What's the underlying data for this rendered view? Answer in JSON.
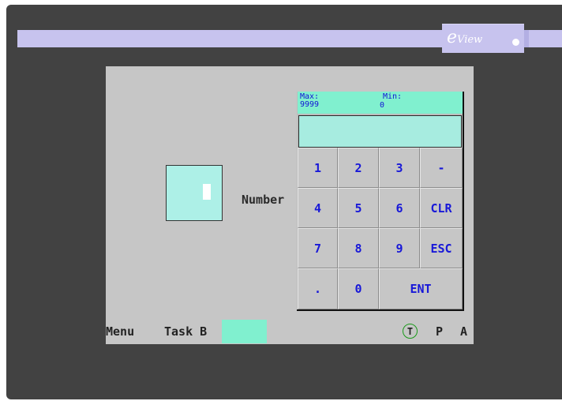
{
  "brand": {
    "logo_mark": "e",
    "logo_text": "View"
  },
  "field": {
    "label": "Number"
  },
  "keypad": {
    "max_label": "Max:",
    "max_value": "9999",
    "min_label": "Min:",
    "min_value": "0",
    "entry_value": "",
    "keys": {
      "k1": "1",
      "k2": "2",
      "k3": "3",
      "minus": "-",
      "k4": "4",
      "k5": "5",
      "k6": "6",
      "clr": "CLR",
      "k7": "7",
      "k8": "8",
      "k9": "9",
      "esc": "ESC",
      "dot": ".",
      "k0": "0",
      "ent": "ENT"
    }
  },
  "status": {
    "menu": "Menu",
    "task": "Task B",
    "t_badge": "T",
    "p": "P",
    "a": "A"
  },
  "colors": {
    "bezel": "#424242",
    "screen": "#c6c6c6",
    "accent_cyan": "#80f0cf",
    "key_text": "#1818d8",
    "brand_bar": "#c7c3ee"
  }
}
